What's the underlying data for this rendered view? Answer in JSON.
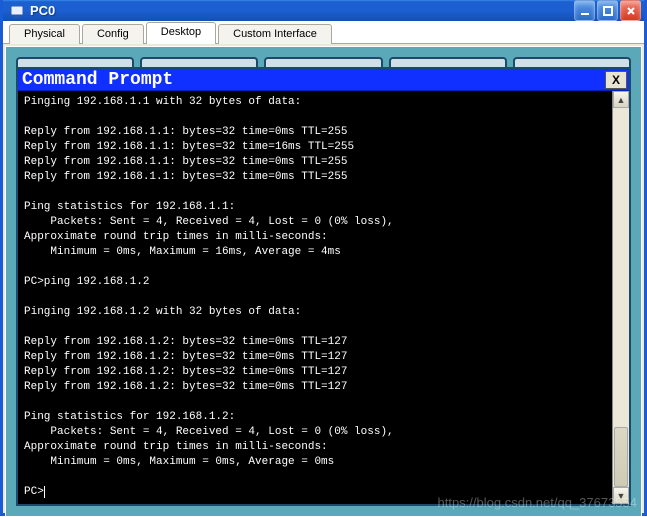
{
  "window": {
    "title": "PC0"
  },
  "tabs": [
    {
      "label": "Physical"
    },
    {
      "label": "Config"
    },
    {
      "label": "Desktop"
    },
    {
      "label": "Custom Interface"
    }
  ],
  "activeTabIndex": 2,
  "commandPrompt": {
    "title": "Command Prompt",
    "closeLabel": "X",
    "lines": [
      "Pinging 192.168.1.1 with 32 bytes of data:",
      "",
      "Reply from 192.168.1.1: bytes=32 time=0ms TTL=255",
      "Reply from 192.168.1.1: bytes=32 time=16ms TTL=255",
      "Reply from 192.168.1.1: bytes=32 time=0ms TTL=255",
      "Reply from 192.168.1.1: bytes=32 time=0ms TTL=255",
      "",
      "Ping statistics for 192.168.1.1:",
      "    Packets: Sent = 4, Received = 4, Lost = 0 (0% loss),",
      "Approximate round trip times in milli-seconds:",
      "    Minimum = 0ms, Maximum = 16ms, Average = 4ms",
      "",
      "PC>ping 192.168.1.2",
      "",
      "Pinging 192.168.1.2 with 32 bytes of data:",
      "",
      "Reply from 192.168.1.2: bytes=32 time=0ms TTL=127",
      "Reply from 192.168.1.2: bytes=32 time=0ms TTL=127",
      "Reply from 192.168.1.2: bytes=32 time=0ms TTL=127",
      "Reply from 192.168.1.2: bytes=32 time=0ms TTL=127",
      "",
      "Ping statistics for 192.168.1.2:",
      "    Packets: Sent = 4, Received = 4, Lost = 0 (0% loss),",
      "Approximate round trip times in milli-seconds:",
      "    Minimum = 0ms, Maximum = 0ms, Average = 0ms",
      "",
      "PC>"
    ]
  },
  "watermark": "https://blog.csdn.net/qq_37673554"
}
